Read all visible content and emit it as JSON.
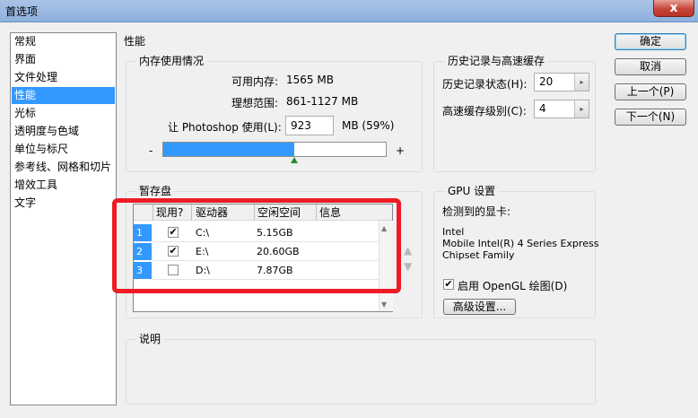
{
  "window": {
    "title": "首选项",
    "close_glyph": "x"
  },
  "categories": [
    "常规",
    "界面",
    "文件处理",
    "性能",
    "光标",
    "透明度与色域",
    "单位与标尺",
    "参考线、网格和切片",
    "增效工具",
    "文字"
  ],
  "selected_category": 3,
  "section_title": "性能",
  "memory": {
    "group": "内存使用情况",
    "available_label": "可用内存:",
    "available_value": "1565 MB",
    "ideal_label": "理想范围:",
    "ideal_value": "861-1127 MB",
    "let_label": "让 Photoshop 使用(L):",
    "let_value": "923",
    "unit": "MB (59%)",
    "minus": "-",
    "plus": "+",
    "slider_fraction": 0.59
  },
  "history": {
    "group": "历史记录与高速缓存",
    "states_label": "历史记录状态(H):",
    "states_value": "20",
    "cache_label": "高速缓存级别(C):",
    "cache_value": "4"
  },
  "scratch": {
    "group": "暂存盘",
    "headers": [
      "现用?",
      "驱动器",
      "空闲空间",
      "信息"
    ],
    "rows": [
      {
        "n": "1",
        "active": "✔",
        "drive": "C:\\",
        "free": "5.15GB"
      },
      {
        "n": "2",
        "active": "✔",
        "drive": "E:\\",
        "free": "20.60GB"
      },
      {
        "n": "3",
        "active": "",
        "drive": "D:\\",
        "free": "7.87GB"
      }
    ]
  },
  "gpu": {
    "group": "GPU 设置",
    "detected_label": "检测到的显卡:",
    "card_lines": [
      "Intel",
      "Mobile Intel(R) 4 Series Express",
      "Chipset Family"
    ],
    "opengl_label": "启用 OpenGL 绘图(D)",
    "opengl_check": "✔",
    "advanced_button": "高级设置..."
  },
  "description": {
    "group": "说明"
  },
  "buttons": {
    "ok": "确定",
    "cancel": "取消",
    "prev": "上一个(P)",
    "next": "下一个(N)"
  },
  "colors": {
    "selection": "#3399ff",
    "annotation": "#ed1c24"
  }
}
